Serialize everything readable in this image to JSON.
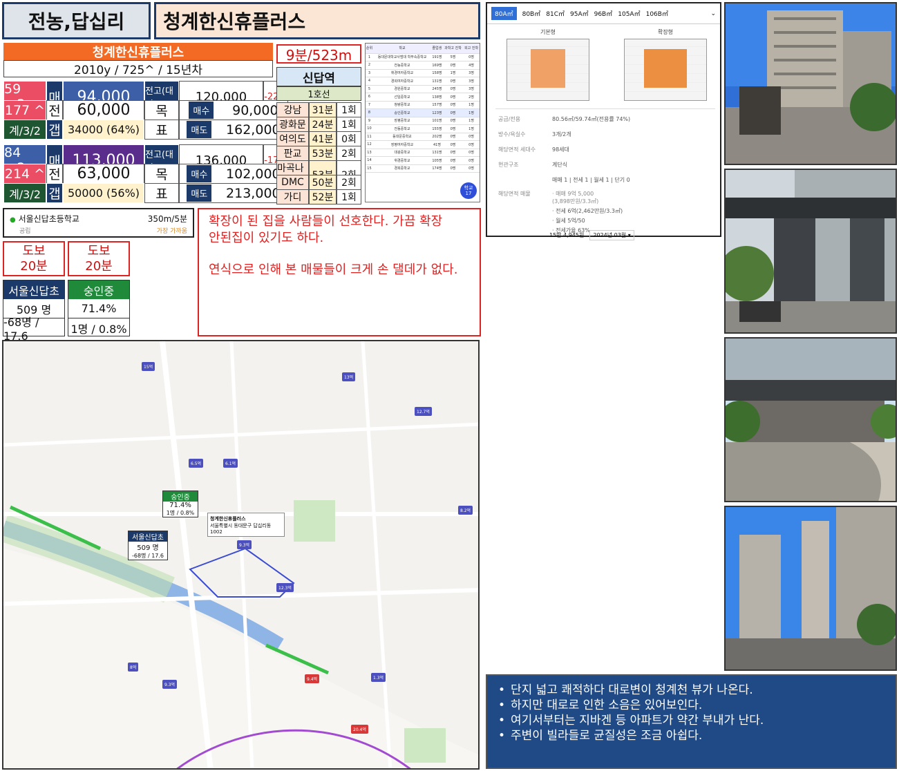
{
  "header": {
    "area": "전농,답십리",
    "complex": "청계한신휴플러스"
  },
  "complex": {
    "name": "청계한신휴플러스",
    "summary": "2010y / 725^ / 15년차"
  },
  "units": [
    {
      "area": "59 m2",
      "households": "177 ^",
      "rooms": "계/3/2",
      "sale_label": "매",
      "sale": "94,000",
      "prev_label": "전고(대비)",
      "prev_high": "120,000",
      "change": "-22%",
      "jeonse_label": "전",
      "jeonse": "60,000",
      "gap_label": "갭",
      "gap": "34000 (64%)",
      "target_label": "목",
      "target_label2": "표",
      "buy_label": "매수",
      "buy": "90,000",
      "sell_label": "매도",
      "sell": "162,000"
    },
    {
      "area": "84 m2",
      "households": "214 ^",
      "rooms": "계/3/2",
      "sale_label": "매",
      "sale": "113,000",
      "prev_label": "전고(대비)",
      "prev_high": "136,000",
      "change": "-17%",
      "jeonse_label": "전",
      "jeonse": "63,000",
      "gap_label": "갭",
      "gap": "50000 (56%)",
      "target_label": "목",
      "target_label2": "표",
      "buy_label": "매수",
      "buy": "102,000",
      "sell_label": "매도",
      "sell": "213,000"
    }
  ],
  "travel": {
    "walk": "9분/523m",
    "station": "신답역",
    "line": "1호선",
    "rows": [
      {
        "dest": "강남",
        "time": "31분",
        "transfer": "1회"
      },
      {
        "dest": "광화문",
        "time": "24분",
        "transfer": "1회"
      },
      {
        "dest": "여의도",
        "time": "41분",
        "transfer": "0회"
      },
      {
        "dest": "판교",
        "time": "53분",
        "transfer": "2회"
      },
      {
        "dest": "마곡나루",
        "time": "53분",
        "transfer": "2회"
      },
      {
        "dest": "DMC",
        "time": "50분",
        "transfer": "2회"
      },
      {
        "dest": "가디",
        "time": "52분",
        "transfer": "1회"
      }
    ]
  },
  "schools_table": {
    "headers": [
      "순위",
      "학교",
      "졸업생",
      "과학고 진학",
      "외고 진학"
    ],
    "rows": [
      [
        "1",
        "동대문대학교사범대 학부속중학교",
        "191명",
        "5명",
        "0명"
      ],
      [
        "2",
        "전농중학교",
        "169명",
        "0명",
        "4명"
      ],
      [
        "3",
        "휘경여자중학교",
        "158명",
        "1명",
        "3명"
      ],
      [
        "4",
        "경희여자중학교",
        "131명",
        "0명",
        "3명"
      ],
      [
        "5",
        "경원중학교",
        "245명",
        "0명",
        "3명"
      ],
      [
        "6",
        "선일중학교",
        "138명",
        "0명",
        "2명"
      ],
      [
        "7",
        "청량중학교",
        "157명",
        "0명",
        "1명"
      ],
      [
        "8",
        "숭인중학교",
        "123명",
        "0명",
        "1명"
      ],
      [
        "9",
        "장평중학교",
        "101명",
        "0명",
        "1명"
      ],
      [
        "10",
        "전동중학교",
        "155명",
        "0명",
        "1명"
      ],
      [
        "11",
        "동대문중학교",
        "202명",
        "0명",
        "0명"
      ],
      [
        "12",
        "장평여자중학교",
        "41명",
        "0명",
        "0명"
      ],
      [
        "13",
        "대광중학교",
        "131명",
        "0명",
        "0명"
      ],
      [
        "14",
        "휘경중학교",
        "105명",
        "0명",
        "0명"
      ],
      [
        "15",
        "경희중학교",
        "174명",
        "0명",
        "0명"
      ]
    ],
    "badge_label": "학교",
    "badge_value": "17"
  },
  "school": {
    "name": "서울신답초등학교",
    "distance": "350m/5분",
    "type": "공립",
    "note": "가장 가까움"
  },
  "comment": {
    "line1": "확장이 된 집을 사람들이 선호한다. 가끔 확장",
    "line2": "안된집이 있기도 하다.",
    "line3": "연식으로 인해 본 매물들이 크게 손 댈데가 없다."
  },
  "walk_elem": {
    "label": "도보",
    "time": "20분"
  },
  "walk_mid": {
    "label": "도보",
    "time": "20분"
  },
  "elem_school": {
    "name": "서울신답초",
    "students": "509 명",
    "ratio": "-68명 / 17.6"
  },
  "mid_school": {
    "name": "숭인중",
    "rate": "71.4%",
    "ratio": "1명 / 0.8%"
  },
  "listing": {
    "tabs": [
      "80A㎡",
      "80B㎡",
      "81C㎡",
      "95A㎡",
      "96B㎡",
      "105A㎡",
      "106B㎡"
    ],
    "plan_basic": "기본형",
    "plan_ext": "확장형",
    "info": [
      {
        "k": "공급/전용",
        "v": "80.56㎡/59.74㎡(전용률 74%)"
      },
      {
        "k": "방수/욕실수",
        "v": "3개/2개"
      },
      {
        "k": "해당면적 세대수",
        "v": "98세대"
      },
      {
        "k": "현관구조",
        "v": "계단식"
      },
      {
        "k": "",
        "v": "매매 1 | 전세 1 | 월세 1 | 단기 0"
      }
    ],
    "deals_label": "해당면적 매물",
    "deals": [
      "· 매매 9억 5,000 (3,898만원/3.3㎡)",
      "· 전세 6억(2,462만원/3.3㎡)",
      "· 월세 5억/50",
      "· 전세가율 63%"
    ],
    "footer_price": "15만 4,945원",
    "footer_date": "2024년 03월"
  },
  "map": {
    "title": "청계한신휴플러스",
    "address": "서울특별시 동대문구 답십리동 1002",
    "mid_name": "숭인중",
    "mid_rate": "71.4%",
    "mid_ratio": "1명 / 0.8%",
    "elem_name": "서울신답초",
    "elem_students": "509 명",
    "elem_ratio": "-68명 / 17.6",
    "price_markers": [
      "15억",
      "13억",
      "12.7억",
      "6.5억",
      "6.1억",
      "9.3억",
      "12.3억",
      "8.2억",
      "9.3억",
      "9.4억",
      "1.3억",
      "8억",
      "20.4억"
    ]
  },
  "notes": [
    "단지 넓고 쾌적하다 대로변이 청계천 뷰가 나온다.",
    "하지만 대로로 인한 소음은 있어보인다.",
    "여기서부터는 지바겐 등 아파트가 약간 부내가 난다.",
    "주변이 빌라들로 균질성은 조금 아쉽다."
  ],
  "colors": {
    "accent_orange": "#f26a24",
    "navy": "#1b3a6a",
    "red": "#d22222",
    "notes_bg": "#1f4a86"
  }
}
